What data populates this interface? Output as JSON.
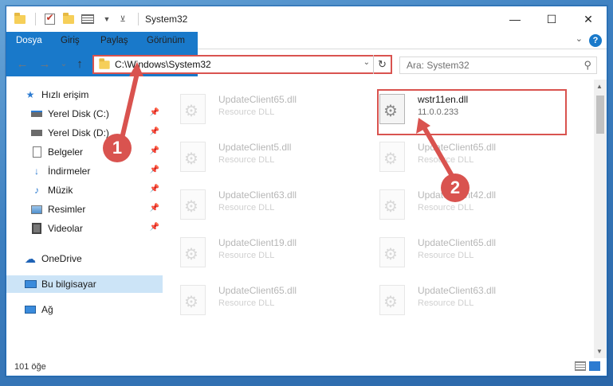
{
  "window": {
    "title": "System32",
    "minimize": "—",
    "maximize": "☐",
    "close": "✕"
  },
  "ribbon": {
    "tabs": [
      "Dosya",
      "Giriş",
      "Paylaş",
      "Görünüm"
    ],
    "help": "?"
  },
  "nav": {
    "back": "←",
    "forward": "→",
    "recent": "⌄",
    "up": "↑",
    "address": "C:\\Windows\\System32",
    "refresh": "↻"
  },
  "search": {
    "placeholder": "Ara: System32"
  },
  "sidebar": {
    "items": [
      {
        "label": "Hızlı erişim",
        "icon": "star-icon"
      },
      {
        "label": "Yerel Disk (C:)",
        "icon": "drive-icon",
        "pinned": true
      },
      {
        "label": "Yerel Disk (D:)",
        "icon": "drive-icon",
        "pinned": true
      },
      {
        "label": "Belgeler",
        "icon": "documents-icon",
        "pinned": true
      },
      {
        "label": "İndirmeler",
        "icon": "download-icon",
        "pinned": true
      },
      {
        "label": "Müzik",
        "icon": "music-icon",
        "pinned": true
      },
      {
        "label": "Resimler",
        "icon": "pictures-icon",
        "pinned": true
      },
      {
        "label": "Videolar",
        "icon": "video-icon",
        "pinned": true
      },
      {
        "label": "OneDrive",
        "icon": "cloud-icon"
      },
      {
        "label": "Bu bilgisayar",
        "icon": "computer-icon",
        "selected": true
      },
      {
        "label": "Ağ",
        "icon": "network-icon"
      }
    ]
  },
  "files": [
    {
      "name": "UpdateClient65.dll",
      "type": "Resource DLL"
    },
    {
      "name": "wstr11en.dll",
      "type": "11.0.0.233"
    },
    {
      "name": "UpdateClient5.dll",
      "type": "Resource DLL"
    },
    {
      "name": "UpdateClient65.dll",
      "type": "Resource DLL"
    },
    {
      "name": "UpdateClient63.dll",
      "type": "Resource DLL"
    },
    {
      "name": "UpdateClient42.dll",
      "type": "Resource DLL"
    },
    {
      "name": "UpdateClient19.dll",
      "type": "Resource DLL"
    },
    {
      "name": "UpdateClient65.dll",
      "type": "Resource DLL"
    },
    {
      "name": "UpdateClient65.dll",
      "type": "Resource DLL"
    },
    {
      "name": "UpdateClient63.dll",
      "type": "Resource DLL"
    }
  ],
  "status": {
    "count": "101 öğe"
  },
  "annotations": {
    "step1": "1",
    "step2": "2",
    "color": "#d9534f"
  }
}
